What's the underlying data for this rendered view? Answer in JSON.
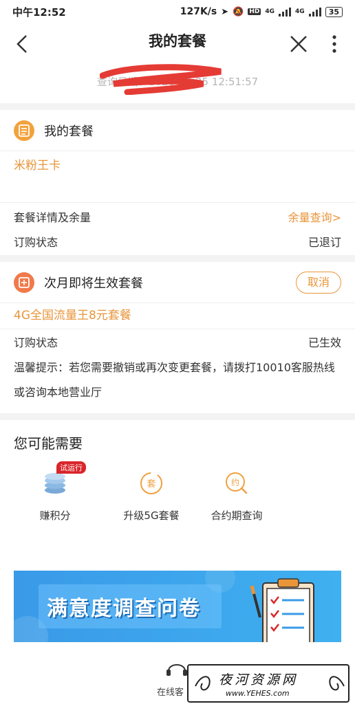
{
  "status_bar": {
    "time": "中午12:52",
    "speed": "127K/s",
    "hd": "HD",
    "net1": "4G",
    "net2": "4G",
    "battery": "35"
  },
  "nav": {
    "title": "我的套餐"
  },
  "query_date": "查询日期：2020-06-25 12:51:57",
  "my_plan": {
    "title": "我的套餐",
    "plan_name": "米粉王卡",
    "rows": [
      {
        "label": "套餐详情及余量",
        "value": "余量查询>"
      },
      {
        "label": "订购状态",
        "value": "已退订"
      }
    ]
  },
  "next_plan": {
    "title": "次月即将生效套餐",
    "cancel_label": "取消",
    "plan_name": "4G全国流量王8元套餐",
    "status_label": "订购状态",
    "status_value": "已生效",
    "tip": "温馨提示：若您需要撤销或再次变更套餐，请拨打10010客服热线或咨询本地营业厅"
  },
  "needs": {
    "title": "您可能需要",
    "items": [
      {
        "label": "赚积分",
        "icon": "coins-icon",
        "badge": "试运行"
      },
      {
        "label": "升级5G套餐",
        "icon": "upgrade-plan-icon",
        "glyph": "套"
      },
      {
        "label": "合约期查询",
        "icon": "contract-search-icon",
        "glyph": "约"
      }
    ]
  },
  "banner": {
    "text": "满意度调查问卷"
  },
  "bottom": {
    "service_label": "在线客"
  },
  "watermark": {
    "title": "夜河资源网",
    "url": "www.YEHES.com"
  },
  "colors": {
    "accent": "#e8953a",
    "badge": "#d9262b",
    "banner": "#3a9ae8"
  }
}
